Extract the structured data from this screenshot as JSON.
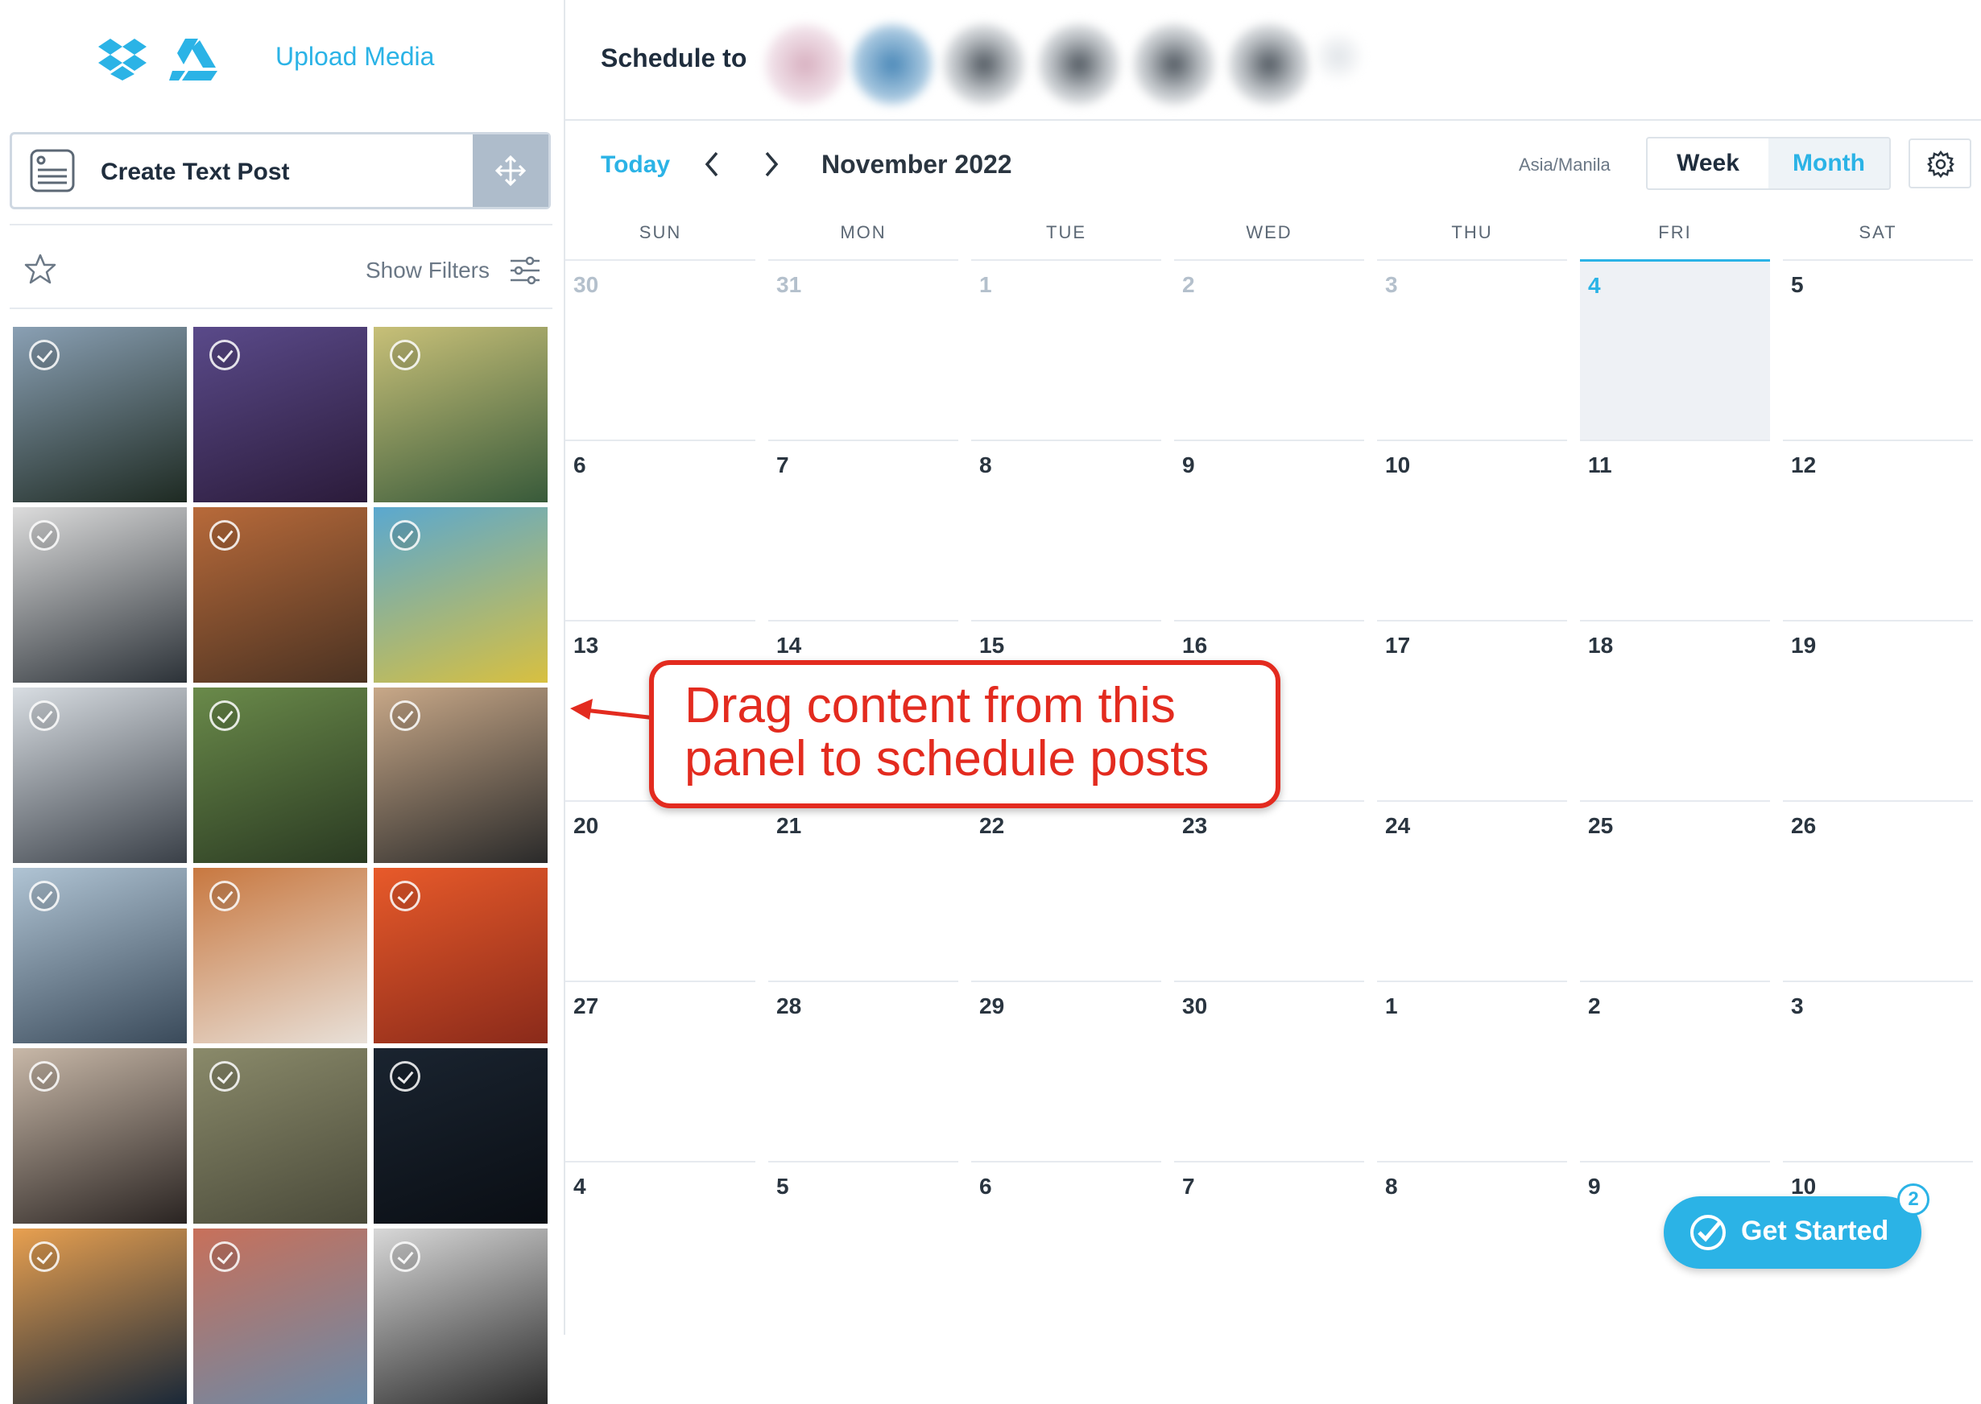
{
  "left_panel": {
    "upload_label": "Upload Media",
    "services": [
      "dropbox-icon",
      "google-drive-icon"
    ],
    "create_text_post": "Create Text Post",
    "show_filters": "Show Filters",
    "media_tiles": [
      {
        "name": "mountain-lake-photo",
        "c1": "#8aa0b4",
        "c2": "#1e2a22"
      },
      {
        "name": "man-in-hat-photo",
        "c1": "#5a4a8a",
        "c2": "#2b1b3a"
      },
      {
        "name": "windsurf-photo",
        "c1": "#c8c078",
        "c2": "#385a3a"
      },
      {
        "name": "laptop-photo",
        "c1": "#dcdcdc",
        "c2": "#2c3238"
      },
      {
        "name": "canyon-photo",
        "c1": "#b86a3a",
        "c2": "#4a3222"
      },
      {
        "name": "gas-truck-photo",
        "c1": "#5aa8d0",
        "c2": "#d8c040"
      },
      {
        "name": "cars-garage-photo",
        "c1": "#d8dde2",
        "c2": "#3a4048"
      },
      {
        "name": "woman-forest-photo",
        "c1": "#6a8a4a",
        "c2": "#2a3a22"
      },
      {
        "name": "woman-laptop-photo",
        "c1": "#c8a888",
        "c2": "#2a2a2a"
      },
      {
        "name": "snowy-mountains-photo",
        "c1": "#b0c4d4",
        "c2": "#3a4a5a"
      },
      {
        "name": "coffee-cups-photo",
        "c1": "#c87840",
        "c2": "#e8e0d8"
      },
      {
        "name": "orange-abstract-photo",
        "c1": "#e85a2a",
        "c2": "#8a2a1a"
      },
      {
        "name": "woman-portrait-photo",
        "c1": "#c8b8a8",
        "c2": "#2a2422"
      },
      {
        "name": "people-outdoors-photo",
        "c1": "#8a8a6a",
        "c2": "#4a4a3a"
      },
      {
        "name": "night-sky-photo",
        "c1": "#1a2430",
        "c2": "#0a0e14"
      },
      {
        "name": "sunset-silhouette-photo",
        "c1": "#e8a050",
        "c2": "#1a2838"
      },
      {
        "name": "building-photo",
        "c1": "#c8705a",
        "c2": "#6a8aa8"
      },
      {
        "name": "person-silhouette-photo",
        "c1": "#d8d8d8",
        "c2": "#2a2a2a"
      }
    ]
  },
  "header": {
    "schedule_to": "Schedule to"
  },
  "toolbar": {
    "today": "Today",
    "month_title": "November 2022",
    "timezone": "Asia/Manila",
    "week": "Week",
    "month": "Month"
  },
  "calendar": {
    "days": [
      "SUN",
      "MON",
      "TUE",
      "WED",
      "THU",
      "FRI",
      "SAT"
    ],
    "weeks": [
      [
        {
          "d": "30",
          "m": true
        },
        {
          "d": "31",
          "m": true
        },
        {
          "d": "1",
          "m": true
        },
        {
          "d": "2",
          "m": true
        },
        {
          "d": "3",
          "m": true
        },
        {
          "d": "4",
          "t": true
        },
        {
          "d": "5"
        }
      ],
      [
        {
          "d": "6"
        },
        {
          "d": "7"
        },
        {
          "d": "8"
        },
        {
          "d": "9"
        },
        {
          "d": "10"
        },
        {
          "d": "11"
        },
        {
          "d": "12"
        }
      ],
      [
        {
          "d": "13"
        },
        {
          "d": "14"
        },
        {
          "d": "15"
        },
        {
          "d": "16"
        },
        {
          "d": "17"
        },
        {
          "d": "18"
        },
        {
          "d": "19"
        }
      ],
      [
        {
          "d": "20"
        },
        {
          "d": "21"
        },
        {
          "d": "22"
        },
        {
          "d": "23"
        },
        {
          "d": "24"
        },
        {
          "d": "25"
        },
        {
          "d": "26"
        }
      ],
      [
        {
          "d": "27"
        },
        {
          "d": "28"
        },
        {
          "d": "29"
        },
        {
          "d": "30"
        },
        {
          "d": "1"
        },
        {
          "d": "2"
        },
        {
          "d": "3"
        }
      ],
      [
        {
          "d": "4"
        },
        {
          "d": "5"
        },
        {
          "d": "6"
        },
        {
          "d": "7"
        },
        {
          "d": "8"
        },
        {
          "d": "9"
        },
        {
          "d": "10"
        }
      ]
    ]
  },
  "callout": {
    "text": "Drag content from this panel to schedule posts"
  },
  "get_started": {
    "label": "Get Started",
    "badge": "2"
  },
  "colors": {
    "accent": "#2bb3e6",
    "callout_red": "#e32b1f"
  }
}
